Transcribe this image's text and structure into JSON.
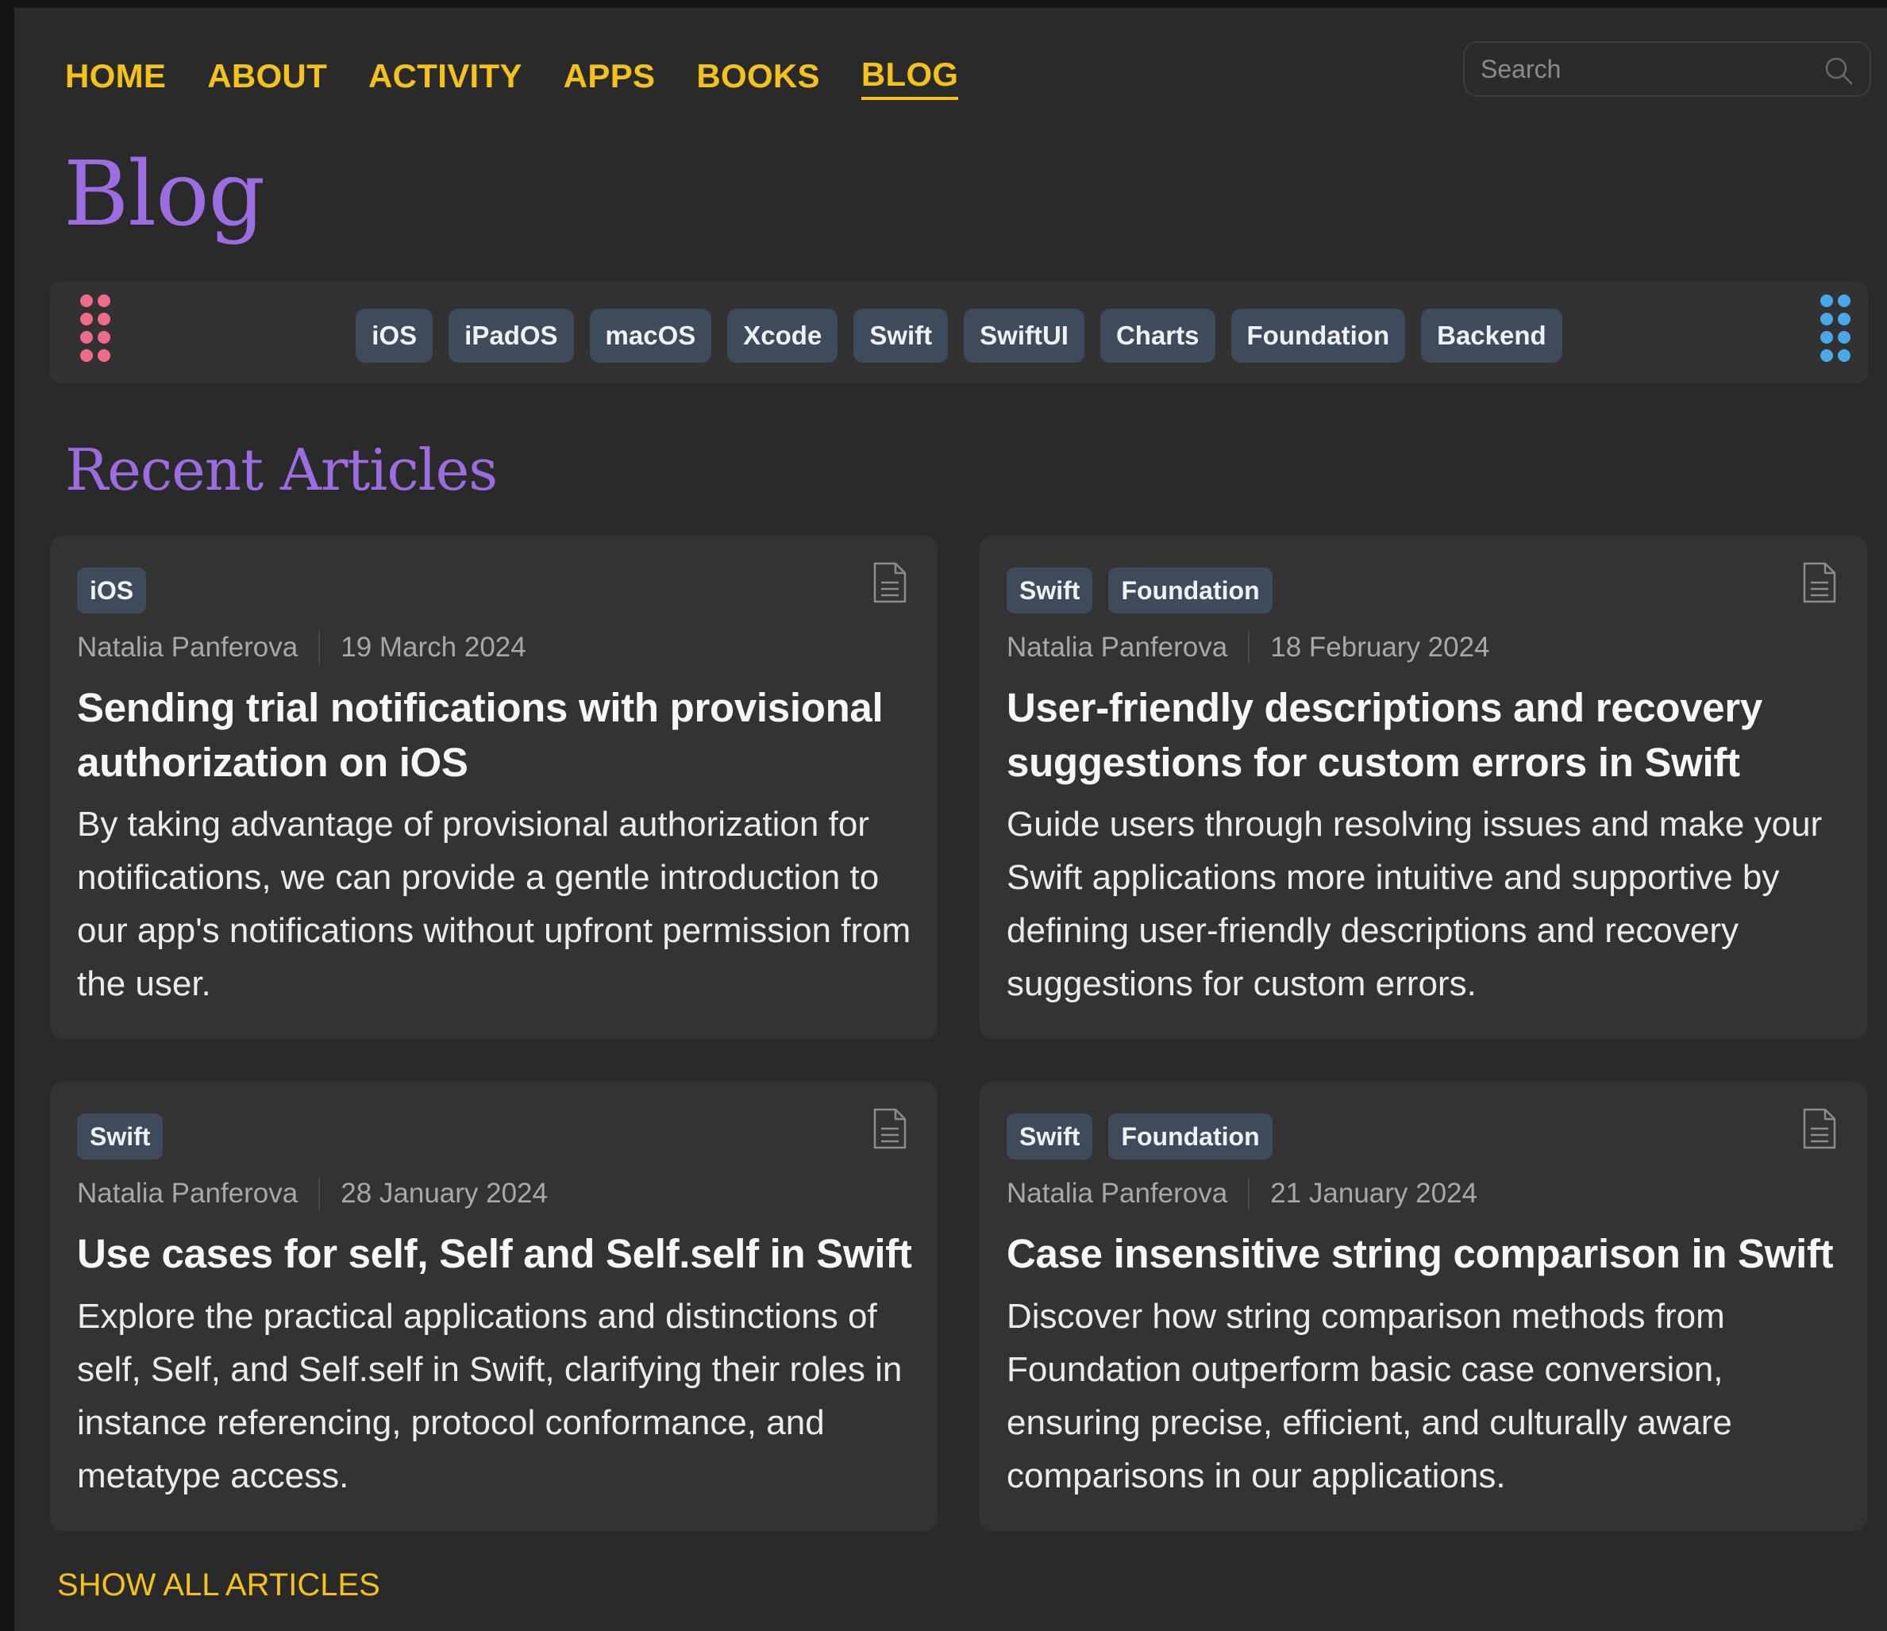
{
  "nav": {
    "items": [
      "HOME",
      "ABOUT",
      "ACTIVITY",
      "APPS",
      "BOOKS",
      "BLOG"
    ],
    "active": "BLOG"
  },
  "search": {
    "placeholder": "Search"
  },
  "page_title": "Blog",
  "tags": [
    "iOS",
    "iPadOS",
    "macOS",
    "Xcode",
    "Swift",
    "SwiftUI",
    "Charts",
    "Foundation",
    "Backend"
  ],
  "section_title": "Recent Articles",
  "articles": [
    {
      "tags": [
        "iOS"
      ],
      "author": "Natalia Panferova",
      "date": "19 March 2024",
      "title": "Sending trial notifications with provisional authorization on iOS",
      "description": "By taking advantage of provisional authorization for notifications, we can provide a gentle introduction to our app's notifications without upfront permission from the user."
    },
    {
      "tags": [
        "Swift",
        "Foundation"
      ],
      "author": "Natalia Panferova",
      "date": "18 February 2024",
      "title": "User-friendly descriptions and recovery suggestions for custom errors in Swift",
      "description": "Guide users through resolving issues and make your Swift applications more intuitive and supportive by defining user-friendly descriptions and recovery suggestions for custom errors."
    },
    {
      "tags": [
        "Swift"
      ],
      "author": "Natalia Panferova",
      "date": "28 January 2024",
      "title": "Use cases for self, Self and Self.self in Swift",
      "description": "Explore the practical applications and distinctions of self, Self, and Self.self in Swift, clarifying their roles in instance referencing, protocol conformance, and metatype access."
    },
    {
      "tags": [
        "Swift",
        "Foundation"
      ],
      "author": "Natalia Panferova",
      "date": "21 January 2024",
      "title": "Case insensitive string comparison in Swift",
      "description": "Discover how string comparison methods from Foundation outperform basic case conversion, ensuring precise, efficient, and culturally aware comparisons in our applications."
    }
  ],
  "show_all": "SHOW ALL ARTICLES",
  "colors": {
    "accent_yellow": "#f5c21b",
    "accent_purple": "#9b6de0",
    "chip_bg": "#3f4b5a",
    "dots_left": "#f06a8a",
    "dots_right": "#4aa8e8"
  }
}
